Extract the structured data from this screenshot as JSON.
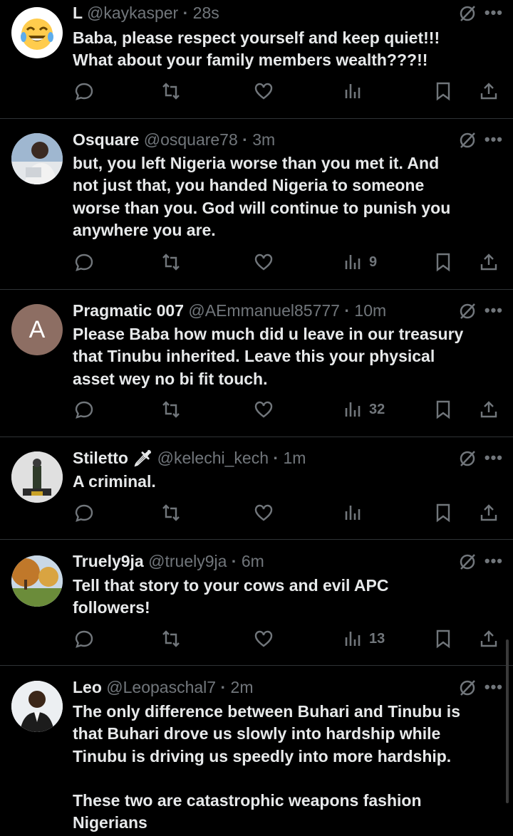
{
  "posts": [
    {
      "name": "L",
      "handle": "@kaykasper",
      "time": "28s",
      "text": "Baba, please respect yourself and keep quiet!!!\nWhat about your family members wealth???!!",
      "views": "",
      "avatar": "laughing-emoji",
      "avatar_bg": "#ffffff"
    },
    {
      "name": "Osquare",
      "handle": "@osquare78",
      "time": "3m",
      "text": "but, you left Nigeria worse than you met it. And\nnot just that, you handed Nigeria to someone\nworse than you. God will continue to punish you\nanywhere you are.",
      "views": "9",
      "avatar": "photo-person",
      "avatar_bg": "#cfd6df"
    },
    {
      "name": "Pragmatic 007",
      "handle": "@AEmmanuel85777",
      "time": "10m",
      "text": "Please Baba how much did u leave in our treasury\nthat Tinubu inherited. Leave this your physical\nasset wey no bi fit touch.",
      "views": "32",
      "avatar": "A",
      "avatar_bg": "#8d6e63"
    },
    {
      "name": "Stiletto",
      "handle": "@kelechi_kech",
      "time": "1m",
      "text": "A criminal.",
      "views": "",
      "avatar": "photo-figurine",
      "avatar_bg": "#d9d9d9",
      "emoji": "🗡"
    },
    {
      "name": "Truely9ja",
      "handle": "@truely9ja",
      "time": "6m",
      "text": "Tell that story to your cows and evil APC\nfollowers!",
      "views": "13",
      "avatar": "photo-landscape",
      "avatar_bg": "#8aa6c0"
    },
    {
      "name": "Leo",
      "handle": "@Leopaschal7",
      "time": "2m",
      "text": "The only difference between Buhari and Tinubu is\nthat  Buhari drove us slowly into hardship while\nTinubu is driving us speedly into more hardship.\n\nThese two are catastrophic weapons fashion\nNigerians",
      "views": "",
      "avatar": "photo-portrait",
      "avatar_bg": "#e8e8e8"
    }
  ]
}
